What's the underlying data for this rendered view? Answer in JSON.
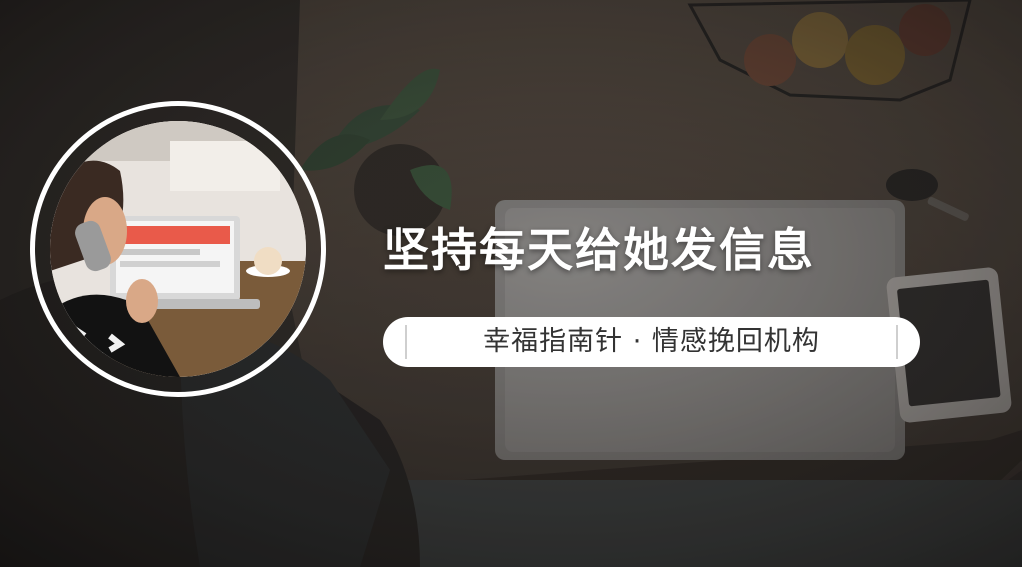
{
  "banner": {
    "headline": "坚持每天给她发信息",
    "tagline": "幸福指南针 · 情感挽回机构"
  },
  "colors": {
    "text_primary": "#ffffff",
    "pill_background": "#ffffff",
    "pill_text": "#333333",
    "ring": "#ffffff"
  }
}
